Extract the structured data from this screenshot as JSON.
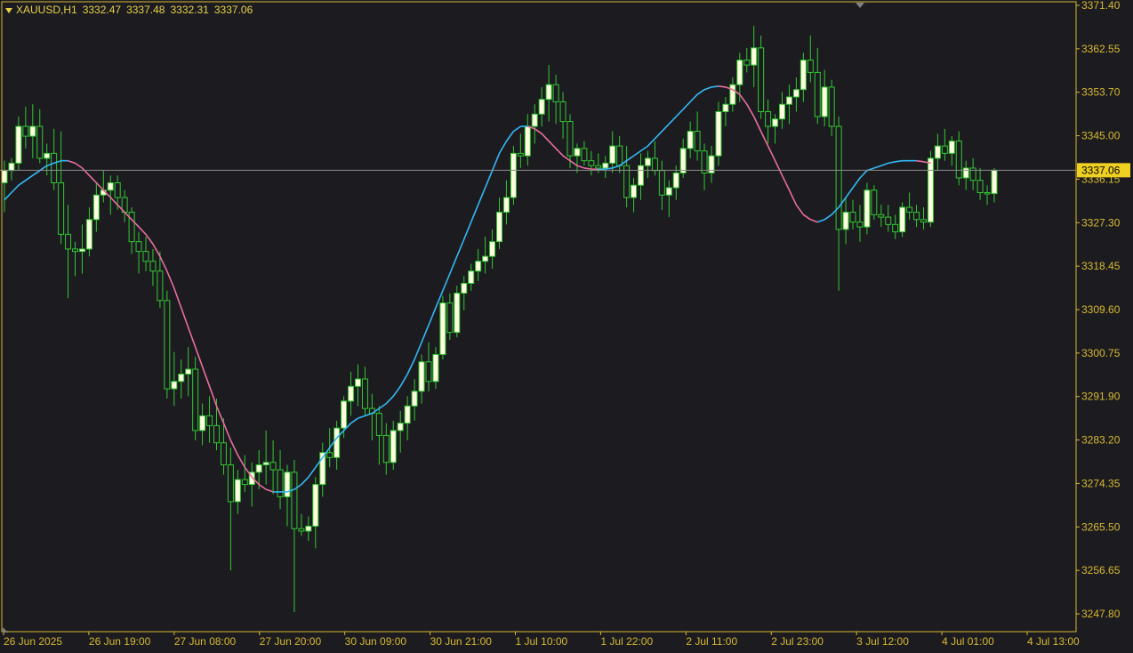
{
  "header": {
    "symbol": "XAUUSD,H1",
    "open": "3332.47",
    "high": "3337.48",
    "low": "3332.31",
    "close": "3337.06"
  },
  "current_price_label": "3337.06",
  "colors": {
    "background": "#1c1c20",
    "axis": "#d8b832",
    "text": "#d8b832",
    "bull_body": "#fffde0",
    "wick": "#32c832",
    "ma_up": "#33b8f5",
    "ma_down": "#e86e9e",
    "price_line": "#8c8c8c",
    "price_tag_bg": "#f0d020",
    "price_tag_text": "#000000"
  },
  "chart_data": {
    "type": "candlestick",
    "title": "XAUUSD,H1",
    "ylim": [
      3243.0,
      3371.4
    ],
    "y_ticks": [
      "3371.40",
      "3362.55",
      "3353.70",
      "3345.00",
      "3336.15",
      "3327.30",
      "3318.45",
      "3309.60",
      "3300.75",
      "3291.90",
      "3283.20",
      "3274.35",
      "3265.50",
      "3256.65",
      "3247.80"
    ],
    "x_ticks": [
      "26 Jun 2025",
      "26 Jun 19:00",
      "27 Jun 08:00",
      "27 Jun 20:00",
      "30 Jun 09:00",
      "30 Jun 21:00",
      "1 Jul 10:00",
      "1 Jul 22:00",
      "2 Jul 11:00",
      "2 Jul 23:00",
      "3 Jul 12:00",
      "4 Jul 01:00",
      "4 Jul 13:00"
    ],
    "current_price": 3337.06,
    "candles": [
      [
        3334.5,
        3339.0,
        3328.5,
        3337.0
      ],
      [
        3337.0,
        3339.5,
        3335.0,
        3338.5
      ],
      [
        3338.5,
        3348.0,
        3337.0,
        3346.0
      ],
      [
        3346.0,
        3350.0,
        3341.5,
        3344.0
      ],
      [
        3344.0,
        3350.5,
        3339.5,
        3346.0
      ],
      [
        3346.0,
        3349.5,
        3338.5,
        3339.5
      ],
      [
        3339.5,
        3342.5,
        3336.0,
        3340.5
      ],
      [
        3340.5,
        3345.5,
        3333.0,
        3334.5
      ],
      [
        3334.5,
        3345.0,
        3322.0,
        3324.0
      ],
      [
        3324.0,
        3330.0,
        3311.0,
        3321.0
      ],
      [
        3321.0,
        3322.5,
        3315.5,
        3320.5
      ],
      [
        3320.5,
        3326.0,
        3316.0,
        3321.0
      ],
      [
        3321.0,
        3329.5,
        3319.5,
        3327.0
      ],
      [
        3327.0,
        3334.5,
        3324.5,
        3332.0
      ],
      [
        3332.0,
        3337.0,
        3330.5,
        3333.0
      ],
      [
        3333.0,
        3336.0,
        3328.0,
        3334.5
      ],
      [
        3334.5,
        3336.0,
        3329.0,
        3331.5
      ],
      [
        3331.5,
        3333.0,
        3326.5,
        3328.5
      ],
      [
        3328.5,
        3329.5,
        3320.0,
        3322.5
      ],
      [
        3322.5,
        3324.5,
        3316.0,
        3320.5
      ],
      [
        3320.5,
        3323.5,
        3316.5,
        3318.5
      ],
      [
        3318.5,
        3321.0,
        3313.5,
        3316.5
      ],
      [
        3316.5,
        3320.5,
        3309.0,
        3310.5
      ],
      [
        3310.5,
        3312.5,
        3290.5,
        3292.5
      ],
      [
        3292.5,
        3300.0,
        3289.0,
        3294.0
      ],
      [
        3294.0,
        3298.5,
        3290.5,
        3295.5
      ],
      [
        3295.5,
        3301.0,
        3291.0,
        3296.5
      ],
      [
        3296.5,
        3299.0,
        3282.0,
        3284.0
      ],
      [
        3284.0,
        3289.5,
        3281.0,
        3287.0
      ],
      [
        3287.0,
        3291.0,
        3281.5,
        3285.0
      ],
      [
        3285.0,
        3290.5,
        3280.0,
        3281.5
      ],
      [
        3281.5,
        3286.5,
        3275.0,
        3277.0
      ],
      [
        3277.0,
        3280.5,
        3255.5,
        3269.5
      ],
      [
        3269.5,
        3276.0,
        3267.0,
        3274.0
      ],
      [
        3274.0,
        3279.0,
        3271.5,
        3273.0
      ],
      [
        3273.0,
        3277.5,
        3268.5,
        3275.5
      ],
      [
        3275.5,
        3280.0,
        3272.0,
        3277.0
      ],
      [
        3277.0,
        3284.0,
        3273.0,
        3277.5
      ],
      [
        3277.5,
        3282.0,
        3271.0,
        3276.0
      ],
      [
        3276.0,
        3280.0,
        3268.0,
        3270.5
      ],
      [
        3270.5,
        3277.0,
        3264.5,
        3275.5
      ],
      [
        3275.5,
        3278.0,
        3247.0,
        3264.0
      ],
      [
        3264.0,
        3267.0,
        3262.5,
        3263.5
      ],
      [
        3263.5,
        3266.5,
        3261.5,
        3264.5
      ],
      [
        3264.5,
        3274.5,
        3260.0,
        3273.0
      ],
      [
        3273.0,
        3281.5,
        3270.5,
        3279.5
      ],
      [
        3279.5,
        3284.5,
        3276.5,
        3278.5
      ],
      [
        3278.5,
        3286.0,
        3276.0,
        3284.5
      ],
      [
        3284.5,
        3291.0,
        3282.5,
        3290.0
      ],
      [
        3290.0,
        3296.0,
        3287.0,
        3293.0
      ],
      [
        3293.0,
        3297.5,
        3289.0,
        3294.5
      ],
      [
        3294.5,
        3297.0,
        3287.0,
        3288.5
      ],
      [
        3288.5,
        3291.5,
        3282.0,
        3287.5
      ],
      [
        3287.5,
        3289.0,
        3277.0,
        3283.0
      ],
      [
        3283.0,
        3285.5,
        3275.0,
        3277.5
      ],
      [
        3277.5,
        3286.0,
        3276.0,
        3284.0
      ],
      [
        3284.0,
        3288.0,
        3279.5,
        3285.5
      ],
      [
        3285.5,
        3291.0,
        3282.0,
        3289.0
      ],
      [
        3289.0,
        3294.5,
        3286.0,
        3292.0
      ],
      [
        3292.0,
        3299.5,
        3289.5,
        3298.0
      ],
      [
        3298.0,
        3302.0,
        3292.0,
        3294.0
      ],
      [
        3294.0,
        3301.0,
        3292.5,
        3299.5
      ],
      [
        3299.5,
        3311.5,
        3298.5,
        3310.0
      ],
      [
        3310.0,
        3312.0,
        3302.5,
        3304.0
      ],
      [
        3304.0,
        3313.5,
        3303.0,
        3312.0
      ],
      [
        3312.0,
        3315.5,
        3308.5,
        3314.0
      ],
      [
        3314.0,
        3318.0,
        3312.5,
        3316.5
      ],
      [
        3316.5,
        3321.0,
        3314.5,
        3318.5
      ],
      [
        3318.5,
        3323.5,
        3316.0,
        3319.5
      ],
      [
        3319.5,
        3325.0,
        3317.0,
        3322.5
      ],
      [
        3322.5,
        3331.5,
        3321.0,
        3328.5
      ],
      [
        3328.5,
        3335.0,
        3326.0,
        3331.5
      ],
      [
        3331.5,
        3342.0,
        3330.0,
        3340.5
      ],
      [
        3340.5,
        3344.5,
        3337.5,
        3340.0
      ],
      [
        3340.0,
        3348.5,
        3338.0,
        3346.0
      ],
      [
        3346.0,
        3350.5,
        3342.5,
        3348.5
      ],
      [
        3348.5,
        3354.0,
        3346.0,
        3351.5
      ],
      [
        3351.5,
        3358.5,
        3347.0,
        3354.5
      ],
      [
        3354.5,
        3356.5,
        3346.5,
        3351.0
      ],
      [
        3351.0,
        3353.0,
        3343.5,
        3347.0
      ],
      [
        3347.0,
        3348.5,
        3337.5,
        3340.0
      ],
      [
        3340.0,
        3342.5,
        3336.5,
        3341.5
      ],
      [
        3341.5,
        3343.0,
        3338.0,
        3339.0
      ],
      [
        3339.0,
        3341.0,
        3336.0,
        3338.0
      ],
      [
        3338.0,
        3340.5,
        3336.5,
        3337.5
      ],
      [
        3337.5,
        3340.0,
        3335.5,
        3338.5
      ],
      [
        3338.5,
        3345.0,
        3336.5,
        3342.0
      ],
      [
        3342.0,
        3344.0,
        3336.5,
        3338.0
      ],
      [
        3338.0,
        3342.0,
        3329.5,
        3331.5
      ],
      [
        3331.5,
        3335.5,
        3328.5,
        3334.0
      ],
      [
        3334.0,
        3340.5,
        3331.0,
        3338.0
      ],
      [
        3338.0,
        3341.0,
        3335.5,
        3339.5
      ],
      [
        3339.5,
        3343.0,
        3336.0,
        3337.0
      ],
      [
        3337.0,
        3339.0,
        3329.0,
        3332.0
      ],
      [
        3332.0,
        3335.0,
        3327.5,
        3333.5
      ],
      [
        3333.5,
        3338.0,
        3331.0,
        3336.5
      ],
      [
        3336.5,
        3343.5,
        3335.5,
        3341.5
      ],
      [
        3341.5,
        3347.0,
        3339.5,
        3345.0
      ],
      [
        3345.0,
        3349.0,
        3339.0,
        3341.0
      ],
      [
        3341.0,
        3342.5,
        3333.0,
        3336.5
      ],
      [
        3336.5,
        3342.0,
        3334.5,
        3340.0
      ],
      [
        3340.0,
        3351.0,
        3338.0,
        3349.0
      ],
      [
        3349.0,
        3352.0,
        3346.0,
        3350.5
      ],
      [
        3350.5,
        3356.0,
        3349.0,
        3354.5
      ],
      [
        3354.5,
        3361.0,
        3351.0,
        3359.5
      ],
      [
        3359.5,
        3362.0,
        3357.0,
        3358.5
      ],
      [
        3358.5,
        3366.5,
        3354.0,
        3362.0
      ],
      [
        3362.0,
        3364.5,
        3347.5,
        3349.0
      ],
      [
        3349.0,
        3351.5,
        3342.5,
        3346.0
      ],
      [
        3346.0,
        3348.5,
        3342.5,
        3347.5
      ],
      [
        3347.5,
        3353.0,
        3345.5,
        3350.5
      ],
      [
        3350.5,
        3354.5,
        3346.5,
        3352.0
      ],
      [
        3352.0,
        3356.0,
        3349.0,
        3353.5
      ],
      [
        3353.5,
        3361.0,
        3351.0,
        3359.5
      ],
      [
        3359.5,
        3364.5,
        3355.0,
        3357.0
      ],
      [
        3357.0,
        3362.0,
        3346.5,
        3348.0
      ],
      [
        3348.0,
        3357.5,
        3346.0,
        3354.0
      ],
      [
        3354.0,
        3355.5,
        3344.0,
        3346.0
      ],
      [
        3346.0,
        3348.0,
        3312.5,
        3325.0
      ],
      [
        3325.0,
        3331.5,
        3322.0,
        3328.5
      ],
      [
        3328.5,
        3331.0,
        3325.0,
        3326.5
      ],
      [
        3326.5,
        3330.0,
        3322.5,
        3325.5
      ],
      [
        3325.5,
        3334.5,
        3324.0,
        3333.0
      ],
      [
        3333.0,
        3334.0,
        3327.0,
        3328.0
      ],
      [
        3328.0,
        3330.0,
        3325.5,
        3327.5
      ],
      [
        3327.5,
        3330.0,
        3324.5,
        3326.0
      ],
      [
        3326.0,
        3328.0,
        3323.0,
        3324.5
      ],
      [
        3324.5,
        3330.5,
        3323.5,
        3329.5
      ],
      [
        3329.5,
        3332.5,
        3327.0,
        3328.5
      ],
      [
        3328.5,
        3330.0,
        3325.5,
        3327.0
      ],
      [
        3327.0,
        3329.5,
        3325.0,
        3326.5
      ],
      [
        3326.5,
        3341.0,
        3325.5,
        3339.5
      ],
      [
        3339.5,
        3344.5,
        3337.0,
        3342.0
      ],
      [
        3342.0,
        3345.5,
        3339.0,
        3340.5
      ],
      [
        3340.5,
        3344.0,
        3338.0,
        3343.0
      ],
      [
        3343.0,
        3345.0,
        3334.0,
        3335.5
      ],
      [
        3335.5,
        3339.0,
        3333.0,
        3337.5
      ],
      [
        3337.5,
        3339.5,
        3333.0,
        3335.0
      ],
      [
        3335.0,
        3337.5,
        3331.0,
        3332.5
      ],
      [
        3332.5,
        3334.0,
        3330.0,
        3332.3
      ],
      [
        3332.3,
        3337.48,
        3330.5,
        3337.06
      ]
    ],
    "ma_line": [
      3331.0,
      3332.5,
      3334.0,
      3335.0,
      3336.0,
      3337.0,
      3338.0,
      3338.5,
      3339.0,
      3339.0,
      3338.5,
      3337.5,
      3336.0,
      3334.5,
      3333.0,
      3331.5,
      3330.0,
      3328.5,
      3327.0,
      3325.5,
      3324.0,
      3322.0,
      3319.5,
      3316.5,
      3313.0,
      3309.0,
      3305.0,
      3301.0,
      3297.0,
      3293.0,
      3289.0,
      3285.5,
      3282.0,
      3279.0,
      3276.5,
      3274.5,
      3273.0,
      3272.0,
      3271.5,
      3271.5,
      3271.5,
      3272.0,
      3273.0,
      3274.5,
      3276.5,
      3278.5,
      3280.5,
      3282.5,
      3284.0,
      3285.5,
      3286.5,
      3287.0,
      3287.5,
      3288.5,
      3289.5,
      3291.0,
      3293.0,
      3295.5,
      3298.5,
      3302.0,
      3305.5,
      3309.0,
      3312.5,
      3316.0,
      3319.5,
      3323.0,
      3326.5,
      3330.0,
      3333.5,
      3337.0,
      3340.5,
      3343.0,
      3345.0,
      3346.0,
      3346.0,
      3345.5,
      3344.5,
      3343.0,
      3341.5,
      3340.0,
      3339.0,
      3338.0,
      3337.5,
      3337.3,
      3337.2,
      3337.3,
      3337.5,
      3338.0,
      3339.0,
      3340.0,
      3341.0,
      3342.0,
      3343.5,
      3345.0,
      3346.5,
      3348.0,
      3349.5,
      3351.0,
      3352.5,
      3353.5,
      3354.0,
      3354.2,
      3354.0,
      3353.5,
      3352.5,
      3350.5,
      3348.0,
      3345.0,
      3342.0,
      3339.0,
      3336.0,
      3333.0,
      3330.0,
      3328.0,
      3327.0,
      3326.5,
      3327.0,
      3328.0,
      3329.5,
      3331.5,
      3333.5,
      3335.5,
      3337.0,
      3337.5,
      3338.0,
      3338.5,
      3338.8,
      3339.0,
      3339.0,
      3339.0,
      3338.8,
      3338.5
    ]
  }
}
